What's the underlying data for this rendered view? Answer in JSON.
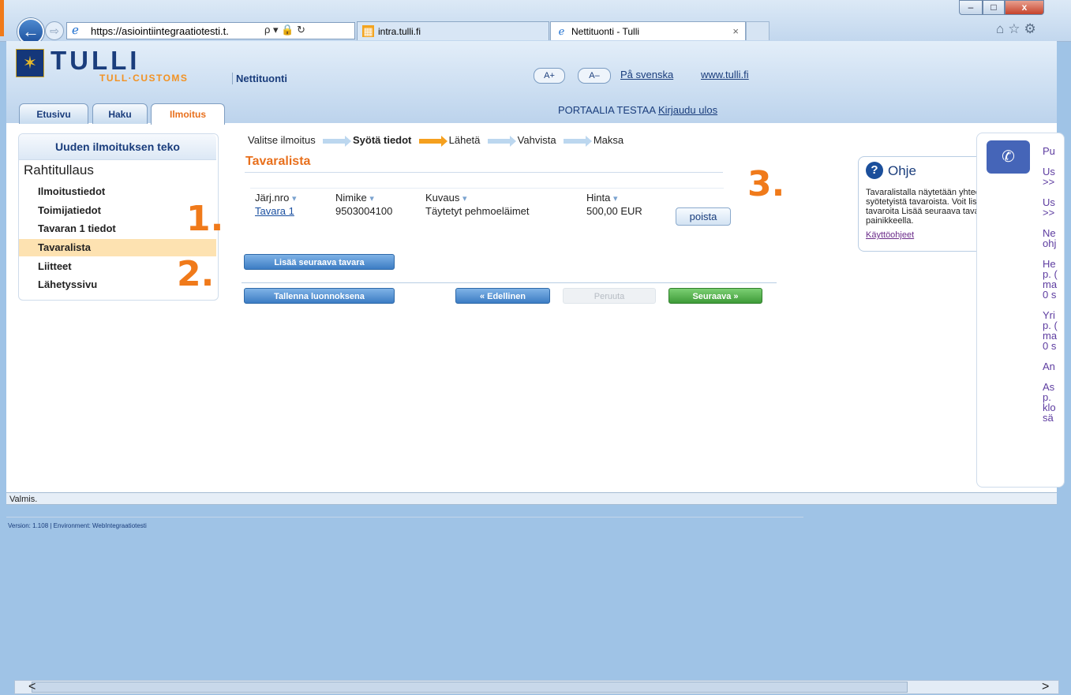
{
  "browser": {
    "url": "https://asiointiintegraatiotesti.t.",
    "addr_tools": "ρ ▾ 🔒 ↻",
    "tabs": [
      {
        "label": "intra.tulli.fi"
      },
      {
        "label": "Nettituonti - Tulli",
        "close": "×"
      }
    ],
    "back": "←",
    "forward": "⇨",
    "window_controls": {
      "min": "–",
      "max": "□",
      "close": "x"
    },
    "right_icons": "⌂☆⚙"
  },
  "header": {
    "logo_text": "TULLI",
    "logo_sub": "TULL·CUSTOMS",
    "app_name": "Nettituonti",
    "font_increase": "A+",
    "font_decrease": "A–",
    "lang_link": "På svenska",
    "site_link": "www.tulli.fi",
    "user_name": "PORTAALIA TESTAA",
    "logout": "Kirjaudu ulos",
    "nav_tabs": [
      {
        "label": "Etusivu"
      },
      {
        "label": "Haku"
      },
      {
        "label": "Ilmoitus",
        "active": true
      }
    ]
  },
  "sidebar": {
    "title": "Uuden ilmoituksen teko",
    "section": "Rahtitullaus",
    "items": [
      {
        "label": "Ilmoitustiedot"
      },
      {
        "label": "Toimijatiedot"
      },
      {
        "label": "Tavaran 1 tiedot"
      },
      {
        "label": "Tavaralista",
        "active": true
      },
      {
        "label": "Liitteet"
      },
      {
        "label": "Lähetyssivu"
      }
    ]
  },
  "annotations": [
    "1.",
    "2.",
    "3."
  ],
  "steps": [
    "Valitse ilmoitus",
    "Syötä tiedot",
    "Lähetä",
    "Vahvista",
    "Maksa"
  ],
  "main": {
    "title": "Tavaralista",
    "columns": [
      "Järj.nro",
      "Nimike",
      "Kuvaus",
      "Hinta"
    ],
    "sort_marker": "▾",
    "rows": [
      {
        "link": "Tavara 1",
        "nimike": "9503004100",
        "kuvaus": "Täytetyt pehmoeläimet",
        "hinta": "500,00 EUR",
        "action": "poista"
      }
    ],
    "add_button": "Lisää seuraava tavara",
    "save_button": "Tallenna luonnoksena",
    "prev_button": "« Edellinen",
    "cancel_button": "Peruuta",
    "next_button": "Seuraava »"
  },
  "help": {
    "title": "Ohje",
    "controls": "–□",
    "text": "Tavaralistalla näytetään yhteenveto syötetyistä tavaroista. Voit lisätä uusia tavaroita Lisää seuraava tavara -painikkeella.",
    "link": "Käyttöohjeet"
  },
  "right_panel": {
    "text": "Pu\n\nUs\n>>\n\nUs\n>>\n\nNe\nohj\n\nHe\np. (\nma\n0 s\n\nYri\np. (\nma\n0 s\n\nAn\n\nAs\np.\nklo\nsä"
  },
  "status": "Valmis.",
  "version": "Version: 1.108 | Environment: WebIntegraatiotesti",
  "scroll": {
    "left": "<",
    "right": ">"
  }
}
